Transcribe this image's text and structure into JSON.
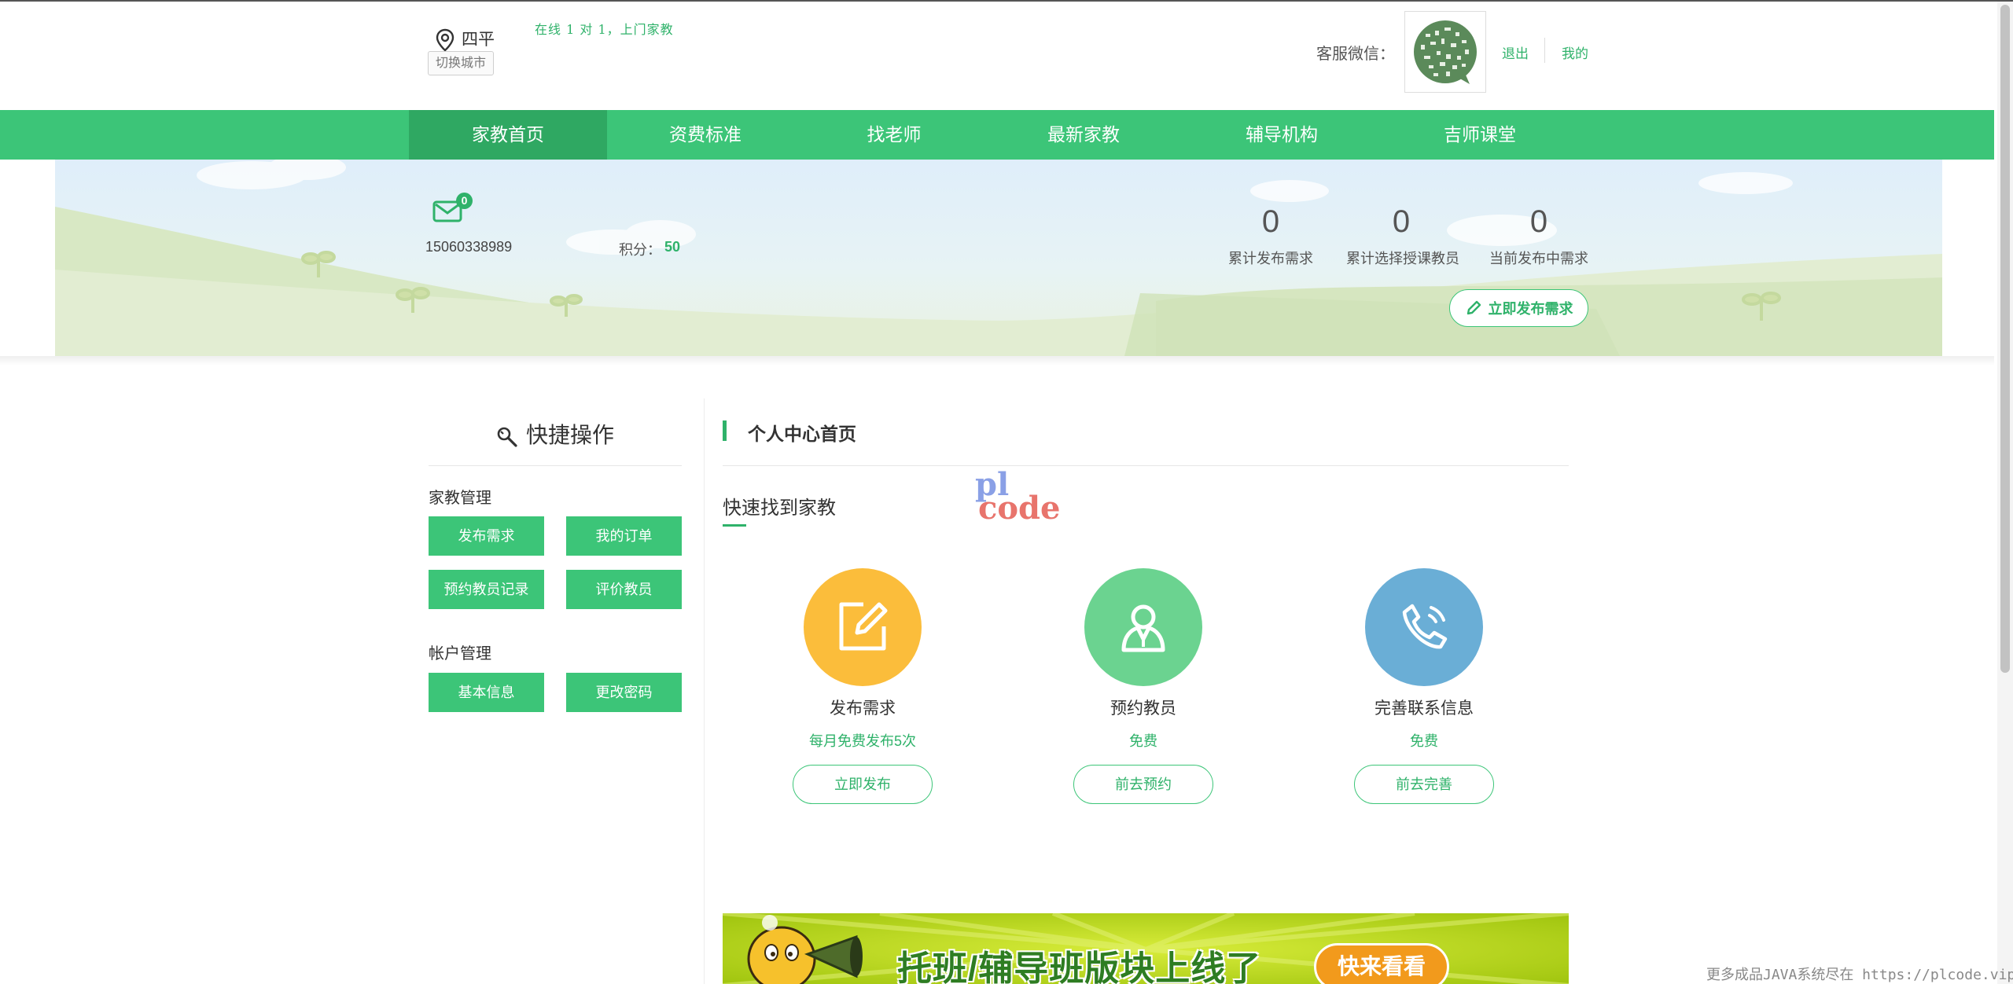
{
  "header": {
    "city": "四平",
    "switch_city": "切换城市",
    "slogan": "在线 1 对 1，上门家教",
    "wechat_label": "客服微信：",
    "logout": "退出",
    "mine": "我的"
  },
  "nav": {
    "items": [
      {
        "label": "家教首页",
        "active": true
      },
      {
        "label": "资费标准"
      },
      {
        "label": "找老师"
      },
      {
        "label": "最新家教"
      },
      {
        "label": "辅导机构"
      },
      {
        "label": "吉师课堂"
      }
    ]
  },
  "user": {
    "unread_messages": "0",
    "phone": "15060338989",
    "points_label": "积分：",
    "points_value": "50"
  },
  "stats": [
    {
      "value": "0",
      "label": "累计发布需求"
    },
    {
      "value": "0",
      "label": "累计选择授课教员"
    },
    {
      "value": "0",
      "label": "当前发布中需求"
    }
  ],
  "publish_now": "立即发布需求",
  "sidebar": {
    "title": "快捷操作",
    "groups": [
      {
        "title": "家教管理",
        "buttons": [
          "发布需求",
          "我的订单",
          "预约教员记录",
          "评价教员"
        ]
      },
      {
        "title": "帐户管理",
        "buttons": [
          "基本信息",
          "更改密码"
        ]
      }
    ]
  },
  "main": {
    "title": "个人中心首页",
    "section_title": "快速找到家教",
    "watermark": {
      "line1": "pl",
      "line2": "code"
    },
    "cards": [
      {
        "title": "发布需求",
        "sub": "每月免费发布5次",
        "button": "立即发布",
        "color": "#fbbd3b",
        "icon": "edit-icon"
      },
      {
        "title": "预约教员",
        "sub": "免费",
        "button": "前去预约",
        "color": "#6bd390",
        "icon": "teacher-icon"
      },
      {
        "title": "完善联系信息",
        "sub": "免费",
        "button": "前去完善",
        "color": "#6aaed6",
        "icon": "phone-icon"
      }
    ]
  },
  "ad": {
    "text": "托班/辅导班版块上线了",
    "button": "快来看看"
  },
  "footer_note": "更多成品JAVA系统尽在 https://plcode.vip",
  "colors": {
    "brand": "#3cc578",
    "brand_dark": "#2fa862",
    "text_green": "#2fb26a"
  }
}
